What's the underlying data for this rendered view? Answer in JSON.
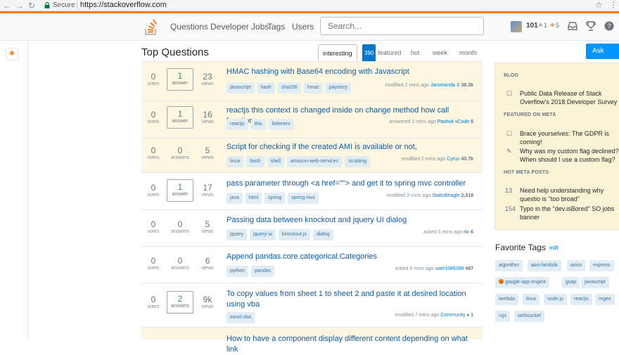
{
  "browser": {
    "secure_label": "Secure",
    "url": "https://stackoverflow.com"
  },
  "topbar": {
    "nav": [
      "Questions",
      "Developer Jobs",
      "Tags",
      "Users"
    ],
    "search_placeholder": "Search...",
    "reputation": "101",
    "silver_badges": "1",
    "bronze_badges": "5",
    "accent_color": "#f48024"
  },
  "main": {
    "title": "Top Questions",
    "filters": {
      "interesting": "interesting",
      "featured_count": "390",
      "featured": "featured",
      "hot": "hot",
      "week": "week",
      "month": "month"
    },
    "questions": [
      {
        "votes": "0",
        "votes_label": "votes",
        "answers": "1",
        "answers_label": "answer",
        "views": "23",
        "views_label": "views",
        "title": "HMAC hashing with Base64 encoding with Javascript",
        "tags": [
          "javascript",
          "hash",
          "sha256",
          "hmac",
          "payeezy"
        ],
        "action": "modified 2 mins ago",
        "user": "Jaromanda X",
        "rep": "38.3k"
      },
      {
        "votes": "0",
        "votes_label": "votes",
        "answers": "1",
        "answers_label": "answer",
        "views": "16",
        "views_label": "views",
        "title": "reactjs this context is changed inside on change method how call function",
        "tags": [
          "reactjs",
          "this",
          "listeners"
        ],
        "action": "answered 2 mins ago",
        "user": "Pashuk xCode",
        "rep": "6"
      },
      {
        "votes": "0",
        "votes_label": "votes",
        "answers": "0",
        "answers_label": "answers",
        "views": "5",
        "views_label": "views",
        "title": "Script for checking if the created AMI is available or not,",
        "tags": [
          "linux",
          "bash",
          "shell",
          "amazon-web-services",
          "scripting"
        ],
        "action": "modified 2 mins ago",
        "user": "Cyrus",
        "rep": "40.7k"
      },
      {
        "votes": "0",
        "votes_label": "votes",
        "answers": "1",
        "answers_label": "answer",
        "views": "17",
        "views_label": "views",
        "title": "pass parameter through <a href=\"\"> and get it to spring mvc controller",
        "tags": [
          "java",
          "html",
          "spring",
          "spring-mvc"
        ],
        "action": "modified 3 mins ago",
        "user": "StaticBeagle",
        "rep": "2,318"
      },
      {
        "votes": "0",
        "votes_label": "votes",
        "answers": "0",
        "answers_label": "answers",
        "views": "5",
        "views_label": "views",
        "title": "Passing data between knockout and jquery UI dialog",
        "tags": [
          "jquery",
          "jquery-ui",
          "knockout.js",
          "dialog"
        ],
        "action": "asked 5 mins ago",
        "user": "rkr",
        "rep": "6"
      },
      {
        "votes": "0",
        "votes_label": "votes",
        "answers": "0",
        "answers_label": "answers",
        "views": "6",
        "views_label": "views",
        "title": "Append pandas.core.categorical.Categories",
        "tags": [
          "python",
          "pandas"
        ],
        "action": "asked 8 mins ago",
        "user": "user3389288",
        "rep": "487"
      },
      {
        "votes": "0",
        "votes_label": "votes",
        "answers": "2",
        "answers_label": "answers",
        "views": "9k",
        "views_label": "views",
        "title": "To copy values from sheet 1 to sheet 2 and paste it at desired location using vba",
        "tags": [
          "excel-vba"
        ],
        "action": "modified 7 mins ago",
        "user": "Community",
        "rep": "♦ 1"
      },
      {
        "title": "How to have a component display different content depending on what link"
      }
    ]
  },
  "sidebar": {
    "ask_button": "Ask Question",
    "blog_heading": "BLOG",
    "blog_items": [
      "Public Data Release of Stack Overflow’s 2018 Developer Survey"
    ],
    "featured_heading": "FEATURED ON META",
    "featured_items": [
      "Brace yourselves: The GDPR is coming!",
      "Why was my custom flag declined? When should I use a custom flag?"
    ],
    "hot_heading": "HOT META POSTS",
    "hot_items": [
      {
        "count": "13",
        "title": "Need help understanding why questio is \"too broad\""
      },
      {
        "count": "154",
        "title": "Typo in the \"dev.isBored\" SO jobs banner"
      }
    ],
    "favorite_title": "Favorite Tags",
    "favorite_edit": "edit",
    "favorite_tags": [
      "algorithm",
      "aws-lambda",
      "axios",
      "express",
      "google-app-engine",
      "gsap",
      "javascript",
      "lambda",
      "linux",
      "node.js",
      "reactjs",
      "regex",
      "rxjs",
      "websocket"
    ]
  }
}
